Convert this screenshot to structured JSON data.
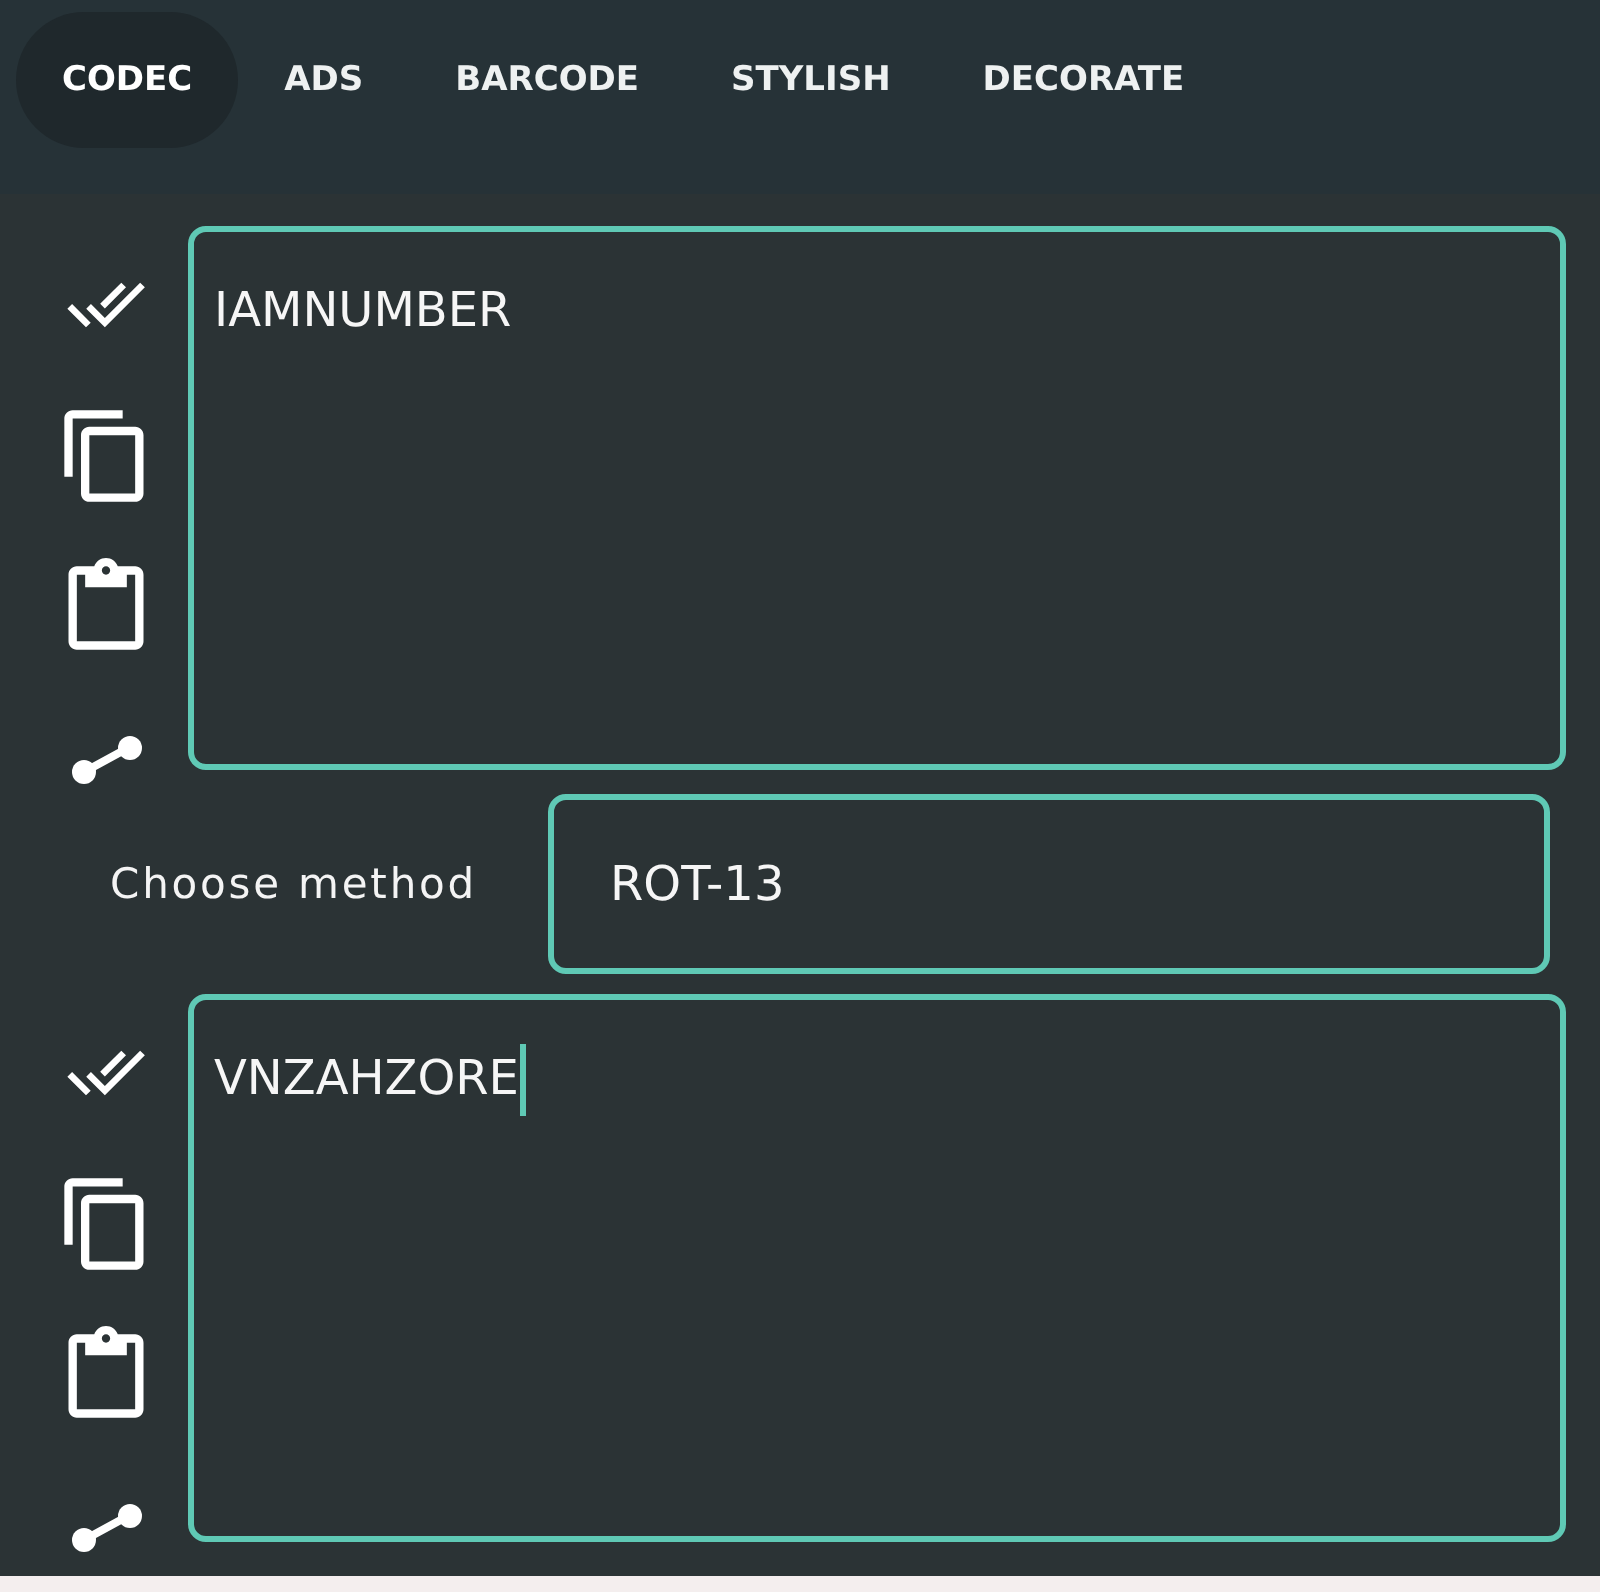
{
  "tabs": [
    {
      "label": "CODEC",
      "selected": true
    },
    {
      "label": "ADS",
      "selected": false
    },
    {
      "label": "BARCODE",
      "selected": false
    },
    {
      "label": "STYLISH",
      "selected": false
    },
    {
      "label": "DECORATE",
      "selected": false
    }
  ],
  "input": {
    "value": "IAMNUMBER",
    "focused": false
  },
  "method": {
    "label": "Choose method",
    "value": "ROT-13"
  },
  "output": {
    "value": "VNZAHZORE",
    "focused": true
  }
}
